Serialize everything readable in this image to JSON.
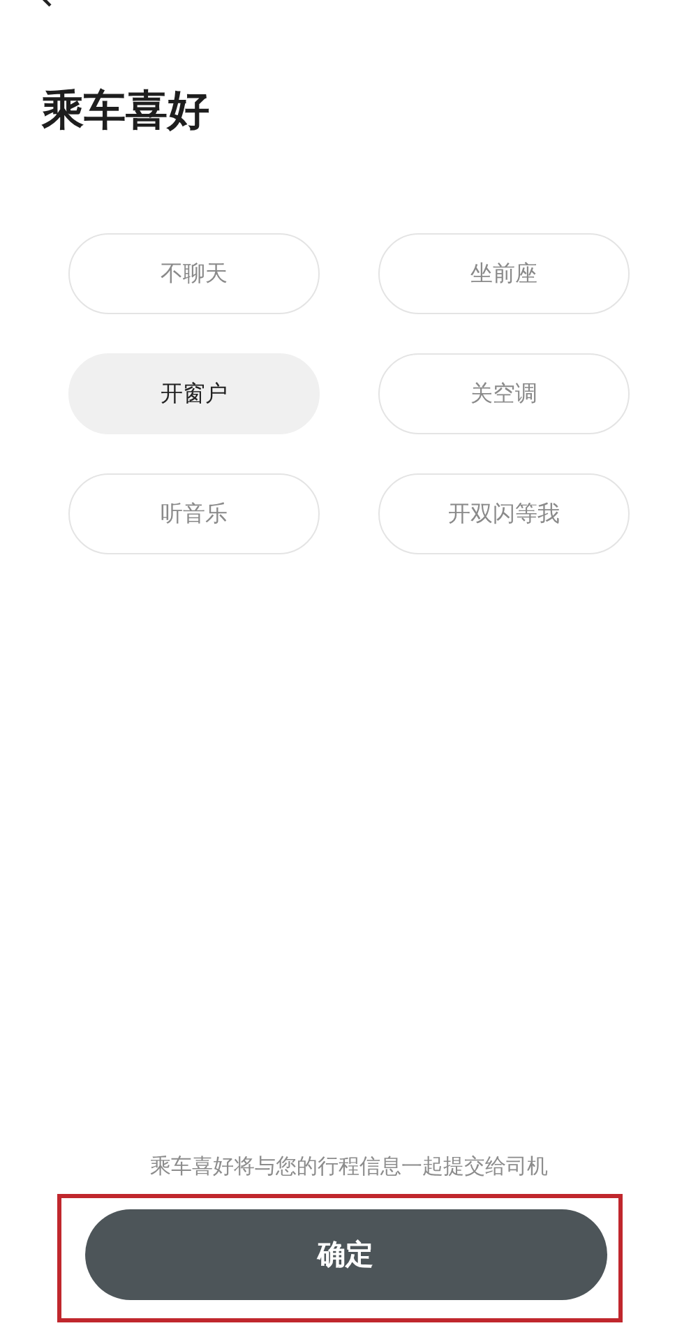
{
  "title": "乘车喜好",
  "preferences": [
    {
      "label": "不聊天",
      "selected": false
    },
    {
      "label": "坐前座",
      "selected": false
    },
    {
      "label": "开窗户",
      "selected": true
    },
    {
      "label": "关空调",
      "selected": false
    },
    {
      "label": "听音乐",
      "selected": false
    },
    {
      "label": "开双闪等我",
      "selected": false
    }
  ],
  "hint": "乘车喜好将与您的行程信息一起提交给司机",
  "confirm_button": {
    "label": "确定",
    "highlighted": true
  }
}
